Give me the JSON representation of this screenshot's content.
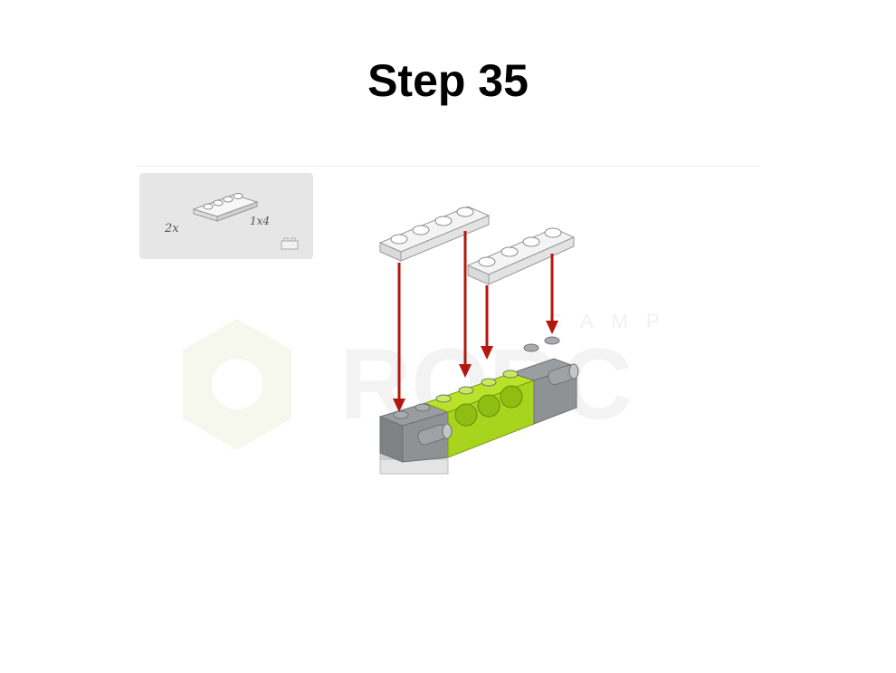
{
  "step": {
    "title": "Step 35"
  },
  "parts": {
    "quantity": "2x",
    "size": "1x4"
  },
  "watermark": {
    "line1": "CAMP",
    "line2": "ROBC"
  },
  "colors": {
    "arrow": "#b3180e",
    "plate": "#f2f2f2",
    "beam_gray": "#8a8d8f",
    "beam_green": "#a7d41c"
  }
}
